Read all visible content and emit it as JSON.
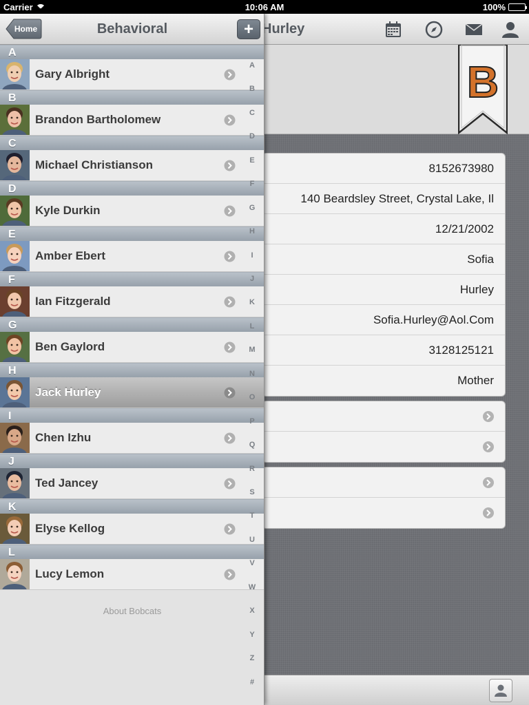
{
  "status_bar": {
    "carrier": "Carrier",
    "time": "10:06 AM",
    "battery": "100%",
    "battery_level": 1.0
  },
  "detail": {
    "title": "Hurley",
    "ribbon_letter": "B",
    "nav_icons": [
      "calendar-icon",
      "compass-icon",
      "mail-icon",
      "person-icon"
    ],
    "info_rows": [
      "8152673980",
      "140 Beardsley Street, Crystal Lake, Il",
      "12/21/2002",
      "Sofia",
      "Hurley",
      "Sofia.Hurley@Aol.Com",
      "3128125121",
      "Mother"
    ],
    "link_groups": [
      2,
      2
    ],
    "toolbar_icon": "contact-card-icon"
  },
  "master": {
    "back_label": "Home",
    "title": "Behavioral",
    "add_label": "+",
    "sections": [
      {
        "letter": "A",
        "name": "Gary Albright",
        "selected": false,
        "avatar_bg": "#8fa6bf",
        "skin": "#f0cfb2",
        "hair": "#d9b46d"
      },
      {
        "letter": "B",
        "name": "Brandon Bartholomew",
        "selected": false,
        "avatar_bg": "#5b6f3a",
        "skin": "#efc0a8",
        "hair": "#4a3020"
      },
      {
        "letter": "C",
        "name": "Michael Christianson",
        "selected": false,
        "avatar_bg": "#55677a",
        "skin": "#e4b79c",
        "hair": "#1f1f2e"
      },
      {
        "letter": "D",
        "name": "Kyle Durkin",
        "selected": false,
        "avatar_bg": "#4f6b3a",
        "skin": "#f0c6a8",
        "hair": "#5a3a22"
      },
      {
        "letter": "E",
        "name": "Amber Ebert",
        "selected": false,
        "avatar_bg": "#7d9ac0",
        "skin": "#f6d2bd",
        "hair": "#c89a5a"
      },
      {
        "letter": "F",
        "name": "Ian Fitzgerald",
        "selected": false,
        "avatar_bg": "#6b3f2f",
        "skin": "#f1c8ad",
        "hair": "#6a4426"
      },
      {
        "letter": "G",
        "name": "Ben Gaylord",
        "selected": false,
        "avatar_bg": "#567043",
        "skin": "#f2c3a4",
        "hair": "#6e4424"
      },
      {
        "letter": "H",
        "name": "Jack Hurley",
        "selected": true,
        "avatar_bg": "#5b7596",
        "skin": "#f2c9ab",
        "hair": "#7a5534"
      },
      {
        "letter": "I",
        "name": "Chen Izhu",
        "selected": false,
        "avatar_bg": "#8a6a4a",
        "skin": "#d8a888",
        "hair": "#2a1f1a"
      },
      {
        "letter": "J",
        "name": "Ted Jancey",
        "selected": false,
        "avatar_bg": "#66707a",
        "skin": "#e9bca0",
        "hair": "#1e2433"
      },
      {
        "letter": "K",
        "name": "Elyse Kellog",
        "selected": false,
        "avatar_bg": "#6a5a3a",
        "skin": "#f3cdb5",
        "hair": "#9a6a3a"
      },
      {
        "letter": "L",
        "name": "Lucy Lemon",
        "selected": false,
        "avatar_bg": "#b0a99a",
        "skin": "#f5d4c0",
        "hair": "#8c5d34"
      }
    ],
    "about": "About Bobcats",
    "index_letters": [
      "A",
      "B",
      "C",
      "D",
      "E",
      "F",
      "G",
      "H",
      "I",
      "J",
      "K",
      "L",
      "M",
      "N",
      "O",
      "P",
      "Q",
      "R",
      "S",
      "T",
      "U",
      "V",
      "W",
      "X",
      "Y",
      "Z",
      "#"
    ]
  }
}
